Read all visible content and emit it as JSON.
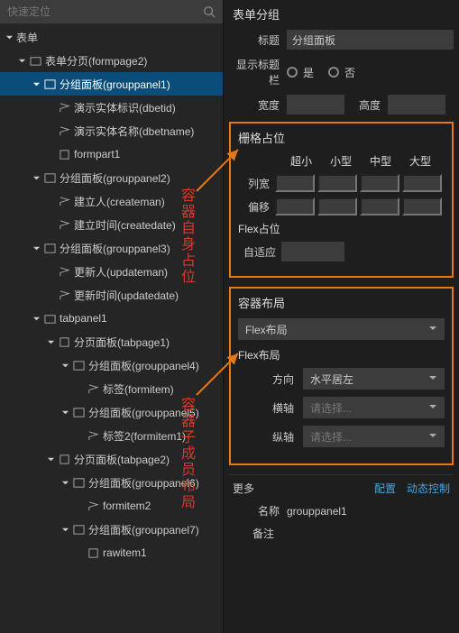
{
  "search": {
    "placeholder": "快速定位"
  },
  "tree": {
    "root": "表单",
    "formpage2": "表单分页(formpage2)",
    "grouppanel1": "分组面板(grouppanel1)",
    "dbetid": "演示实体标识(dbetid)",
    "dbetname": "演示实体名称(dbetname)",
    "formpart1": "formpart1",
    "grouppanel2": "分组面板(grouppanel2)",
    "createman": "建立人(createman)",
    "createdate": "建立时间(createdate)",
    "grouppanel3": "分组面板(grouppanel3)",
    "updateman": "更新人(updateman)",
    "updatedate": "更新时间(updatedate)",
    "tabpanel1": "tabpanel1",
    "tabpage1": "分页面板(tabpage1)",
    "grouppanel4": "分组面板(grouppanel4)",
    "formitem": "标签(formitem)",
    "grouppanel5": "分组面板(grouppanel5)",
    "formitem1": "标签2(formitem1)",
    "tabpage2": "分页面板(tabpage2)",
    "grouppanel6": "分组面板(grouppanel6)",
    "formitem2": "formitem2",
    "grouppanel7": "分组面板(grouppanel7)",
    "rawitem1": "rawitem1"
  },
  "right": {
    "header": "表单分组",
    "title_label": "标题",
    "title_value": "分组面板",
    "show_title_label": "显示标题栏",
    "yes": "是",
    "no": "否",
    "width_label": "宽度",
    "height_label": "高度",
    "grid_box": {
      "title": "栅格占位",
      "col_xs": "超小",
      "col_sm": "小型",
      "col_md": "中型",
      "col_lg": "大型",
      "row_width": "列宽",
      "row_offset": "偏移",
      "flex_title": "Flex占位",
      "auto_label": "自适应"
    },
    "layout_box": {
      "title": "容器布局",
      "layout_type": "Flex布局",
      "flex_title": "Flex布局",
      "dir_label": "方向",
      "dir_value": "水平居左",
      "hax_label": "横轴",
      "hax_placeholder": "请选择...",
      "vax_label": "纵轴",
      "vax_placeholder": "请选择..."
    },
    "more": {
      "label": "更多",
      "config": "配置",
      "dynamic": "动态控制",
      "name_label": "名称",
      "name_value": "grouppanel1",
      "remark_label": "备注"
    }
  },
  "annotations": {
    "a1": "容器自身占位",
    "a2": "容器子成员布局"
  }
}
